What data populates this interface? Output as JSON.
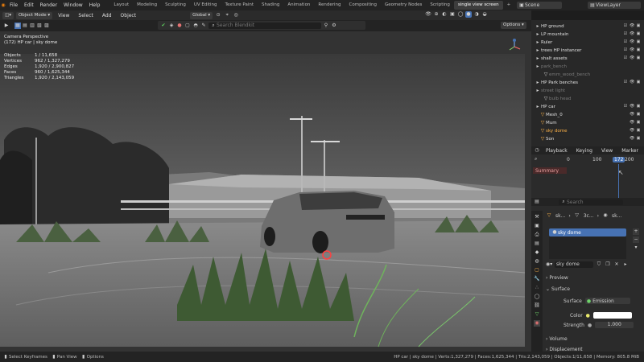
{
  "menu": [
    "File",
    "Edit",
    "Render",
    "Window",
    "Help"
  ],
  "workspaces": [
    "Layout",
    "Modeling",
    "Sculpting",
    "UV Editing",
    "Texture Paint",
    "Shading",
    "Animation",
    "Rendering",
    "Compositing",
    "Geometry Nodes",
    "Scripting",
    "single view screen"
  ],
  "active_workspace_index": 11,
  "scene_name": "Scene",
  "view_layer": "ViewLayer",
  "header": {
    "mode": "Object Mode",
    "view": "View",
    "select": "Select",
    "add": "Add",
    "object": "Object",
    "transform": "Global",
    "options": "Options"
  },
  "viewport": {
    "search_placeholder": "Search Blendkit",
    "camera_label": "Camera Perspective",
    "selection_label": "(172) HP car | sky dome",
    "stats": [
      {
        "label": "Objects",
        "value": "1 / 11,658"
      },
      {
        "label": "Vertices",
        "value": "962 / 1,327,279"
      },
      {
        "label": "Edges",
        "value": "1,920 / 2,900,827"
      },
      {
        "label": "Faces",
        "value": "960 / 1,625,344"
      },
      {
        "label": "Triangles",
        "value": "1,920 / 2,143,059"
      }
    ]
  },
  "outliner": {
    "search_placeholder": "",
    "rows": [
      {
        "name": "HP ground",
        "style": ""
      },
      {
        "name": "LP mountain",
        "style": ""
      },
      {
        "name": "Ruler",
        "style": ""
      },
      {
        "name": "trees HP instancer",
        "style": ""
      },
      {
        "name": "shalt assets",
        "style": ""
      },
      {
        "name": "park_bench",
        "style": "dim"
      },
      {
        "name": "emm_wood_bench",
        "style": "dim"
      },
      {
        "name": "HP Park benches",
        "style": ""
      },
      {
        "name": "street light",
        "style": "dim"
      },
      {
        "name": "bulb head",
        "style": "dim"
      },
      {
        "name": "HP car",
        "style": ""
      },
      {
        "name": "Mesh_0",
        "style": ""
      },
      {
        "name": "Mum",
        "style": ""
      },
      {
        "name": "sky dome",
        "style": "sel"
      },
      {
        "name": "Son",
        "style": ""
      }
    ]
  },
  "timeline": {
    "playback": "Playback",
    "keying": "Keying",
    "view": "View",
    "marker": "Marker",
    "start": "0",
    "mid": "100",
    "current": "172",
    "end": "200",
    "summary": "Summary"
  },
  "properties": {
    "search_placeholder": "Search",
    "crumb1": "sk...",
    "crumb2": "3c...",
    "crumb3": "sk...",
    "material_slot": "sky dome",
    "material_name": "sky dome",
    "preview": "Preview",
    "surface_section": "Surface",
    "surface_label": "Surface",
    "surface_value": "Emission",
    "color_label": "Color",
    "strength_label": "Strength",
    "strength_value": "1.000",
    "volume": "Volume",
    "displacement": "Displacement"
  },
  "statusbar": {
    "left1": "Select Keyframes",
    "left2": "Pan View",
    "left3": "Options",
    "right": "HP car | sky dome | Verts:1,327,279 | Faces:1,625,344 | Tris:2,143,059 | Objects:1/11,658 | Memory: 805.8 MiB"
  },
  "colors": {
    "accent": "#4772b3",
    "selected": "#ffb347",
    "bg": "#1d1d1d"
  }
}
